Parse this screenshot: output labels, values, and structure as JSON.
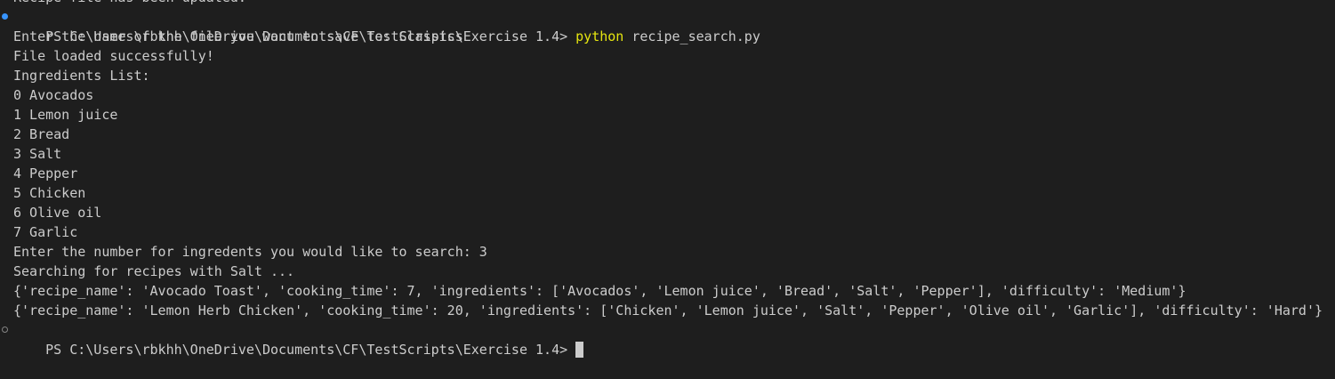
{
  "terminal": {
    "prev_output": "Recipe file has been updated.",
    "first_prompt": {
      "prompt": "PS C:\\Users\\rbkhh\\OneDrive\\Documents\\CF\\TestScripts\\Exercise 1.4> ",
      "command": "python",
      "args": " recipe_search.py"
    },
    "output": [
      "Enter the name of the file you want to save to: Classics",
      "File loaded successfully!",
      "Ingredients List:",
      "0 Avocados",
      "1 Lemon juice",
      "2 Bread",
      "3 Salt",
      "4 Pepper",
      "5 Chicken",
      "6 Olive oil",
      "7 Garlic",
      "Enter the number for ingredents you would like to search: 3",
      "Searching for recipes with Salt ...",
      "{'recipe_name': 'Avocado Toast', 'cooking_time': 7, 'ingredients': ['Avocados', 'Lemon juice', 'Bread', 'Salt', 'Pepper'], 'difficulty': 'Medium'}",
      "{'recipe_name': 'Lemon Herb Chicken', 'cooking_time': 20, 'ingredients': ['Chicken', 'Lemon juice', 'Salt', 'Pepper', 'Olive oil', 'Garlic'], 'difficulty': 'Hard'}"
    ],
    "current_prompt": "PS C:\\Users\\rbkhh\\OneDrive\\Documents\\CF\\TestScripts\\Exercise 1.4>"
  },
  "colors": {
    "background": "#1e1e1e",
    "text": "#cccccc",
    "command": "#e5e510",
    "success_marker": "#3794ff",
    "pending_marker": "#848484"
  }
}
